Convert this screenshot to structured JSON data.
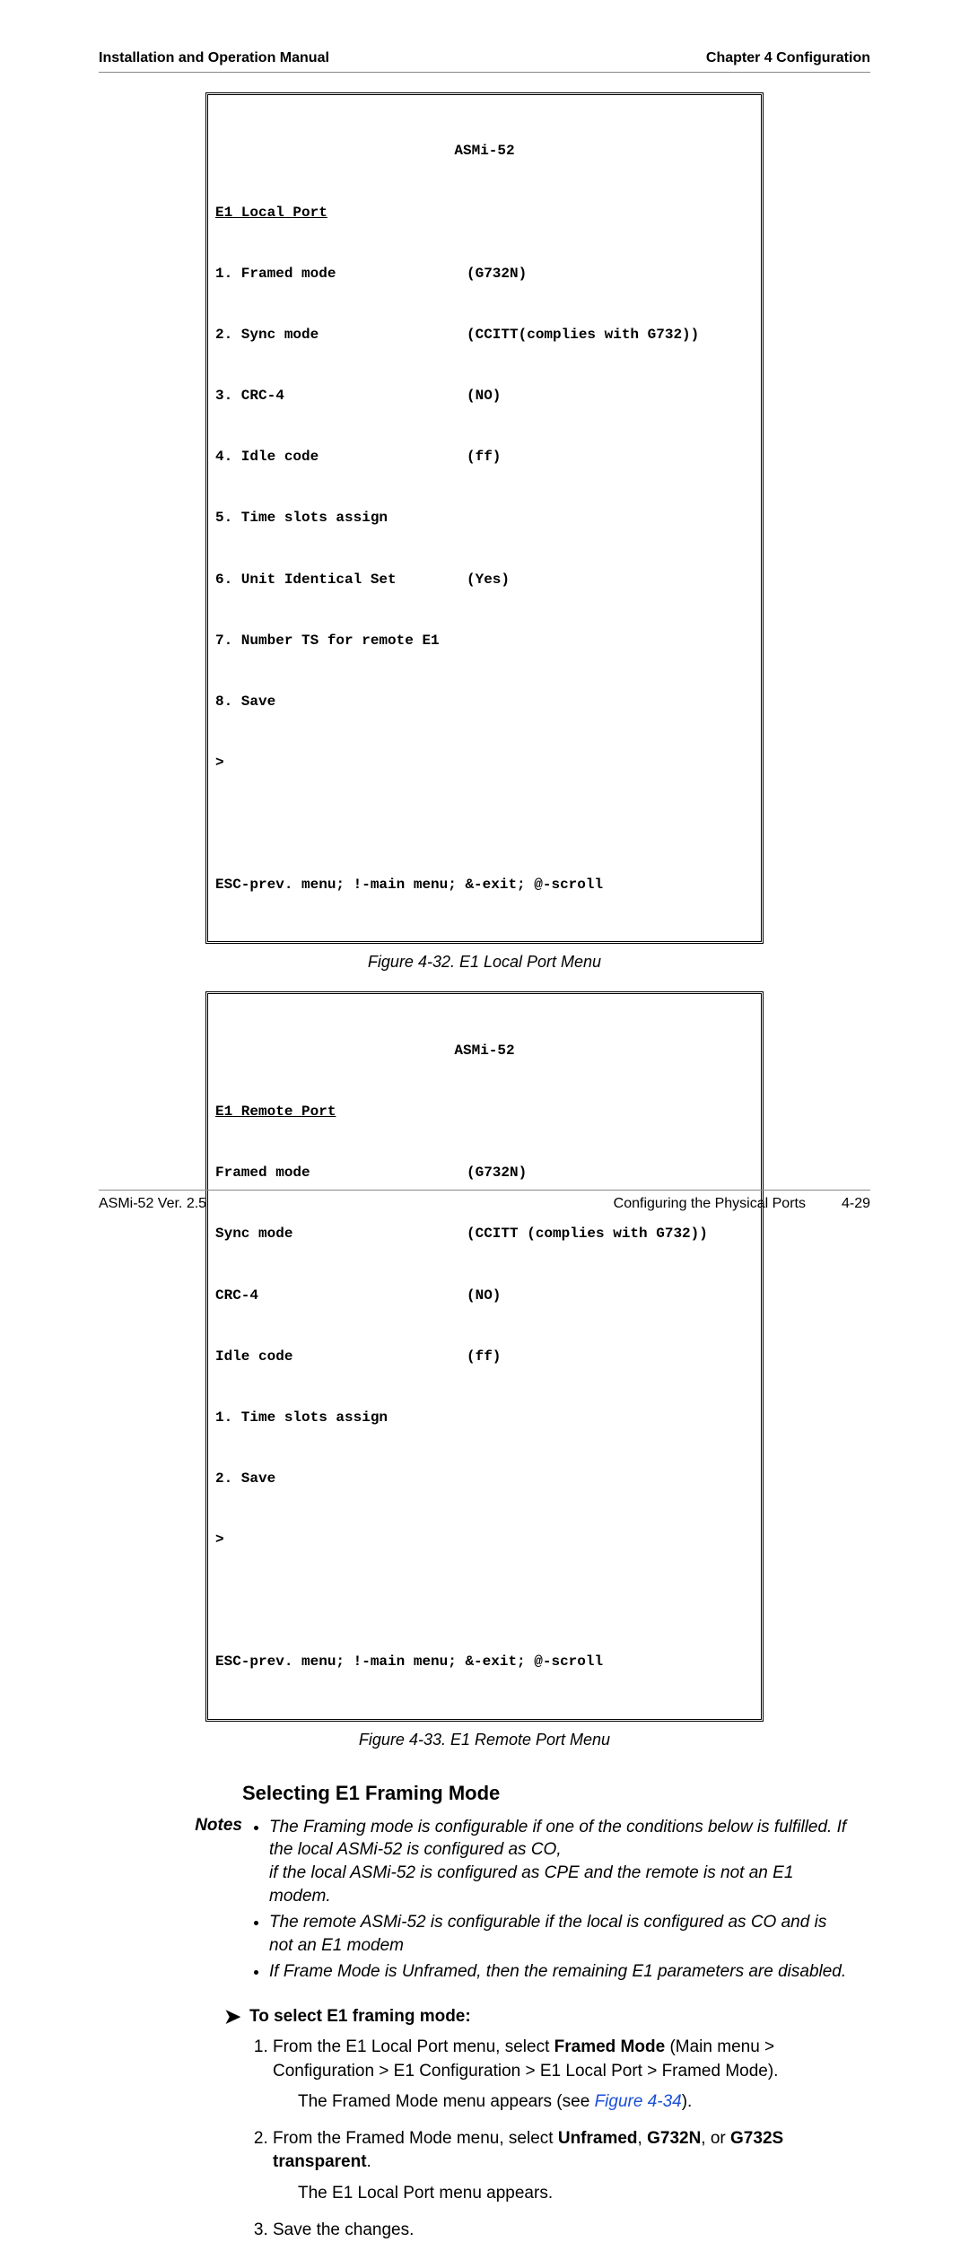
{
  "header": {
    "left": "Installation and Operation Manual",
    "right": "Chapter 4  Configuration"
  },
  "terminal1": {
    "device": "ASMi-52",
    "section": "E1 Local Port",
    "rows": [
      {
        "l": "1. Framed mode",
        "r": "(G732N)"
      },
      {
        "l": "2. Sync mode",
        "r": "(CCITT(complies with G732))"
      },
      {
        "l": "3. CRC-4",
        "r": "(NO)"
      },
      {
        "l": "4. Idle code",
        "r": "(ff)"
      },
      {
        "l": "5. Time slots assign",
        "r": ""
      },
      {
        "l": "6. Unit Identical Set",
        "r": "(Yes)"
      },
      {
        "l": "7. Number TS for remote E1",
        "r": ""
      },
      {
        "l": "8. Save",
        "r": ""
      }
    ],
    "prompt": ">",
    "help": "ESC-prev. menu; !-main menu; &-exit; @-scroll"
  },
  "caption1": "Figure 4-32.  E1 Local Port Menu",
  "terminal2": {
    "device": "ASMi-52",
    "section": "E1 Remote Port",
    "rows": [
      {
        "l": "Framed mode",
        "r": "(G732N)"
      },
      {
        "l": "Sync mode",
        "r": "(CCITT (complies with G732))"
      },
      {
        "l": "CRC-4",
        "r": "(NO)"
      },
      {
        "l": "Idle code",
        "r": "(ff)"
      },
      {
        "l": "1. Time slots assign",
        "r": ""
      },
      {
        "l": "2. Save",
        "r": ""
      }
    ],
    "prompt": ">",
    "help": "ESC-prev. menu; !-main menu; &-exit; @-scroll"
  },
  "caption2": "Figure 4-33.  E1 Remote Port Menu",
  "heading": "Selecting E1 Framing Mode",
  "notes_label": "Notes",
  "notes": [
    "The Framing mode is configurable if one of the conditions below is fulfilled. If the local ASMi-52 is configured as CO,\nif the local ASMi-52 is configured as CPE and the remote is not an E1 modem.",
    "The remote ASMi-52 is configurable if the local is configured as CO and is not an E1 modem",
    "If Frame Mode is Unframed, then the remaining E1 parameters are disabled."
  ],
  "proc_title": "To select E1 framing mode:",
  "steps": {
    "s1a": "From the E1 Local Port menu, select ",
    "s1b": "Framed Mode",
    "s1c": " (Main menu > Configuration > E1 Configuration > E1 Local Port > Framed Mode).",
    "s1sub_a": "The Framed Mode menu appears (see ",
    "s1sub_link": "Figure 4-34",
    "s1sub_b": ").",
    "s2a": "From the Framed Mode menu, select ",
    "s2b": "Unframed",
    "s2c": ", ",
    "s2d": "G732N",
    "s2e": ", or ",
    "s2f": "G732S transparent",
    "s2g": ".",
    "s2sub": "The E1 Local Port menu appears.",
    "s3": "Save the changes."
  },
  "footer": {
    "left": "ASMi-52 Ver. 2.5",
    "right1": "Configuring the Physical Ports",
    "right2": "4-29"
  }
}
